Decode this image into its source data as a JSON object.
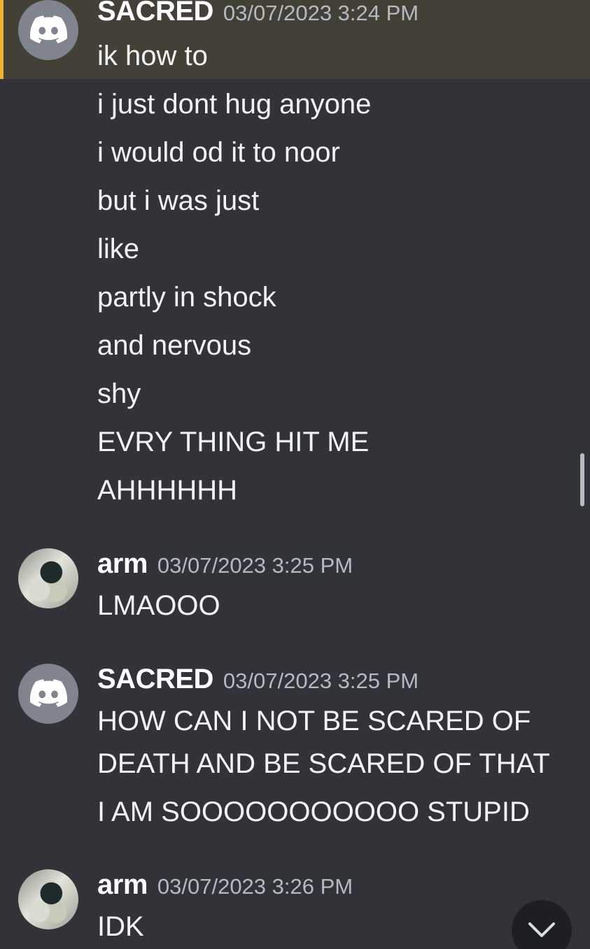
{
  "messages": [
    {
      "author": "SACRED",
      "avatar_icon": "discord-logo-icon",
      "timestamp": "03/07/2023 3:24 PM",
      "highlighted": true,
      "lines": [
        "ik how to",
        "i just dont hug anyone",
        "i would od it to noor",
        "but i was just",
        "like",
        "partly in shock",
        "and nervous",
        "shy",
        "EVRY THING HIT ME",
        "AHHHHHH"
      ]
    },
    {
      "author": "arm",
      "avatar_icon": "user-photo-avatar",
      "timestamp": "03/07/2023 3:25 PM",
      "lines": [
        "LMAOOO"
      ]
    },
    {
      "author": "SACRED",
      "avatar_icon": "discord-logo-icon",
      "timestamp": "03/07/2023 3:25 PM",
      "lines": [
        "HOW CAN I NOT BE SCARED OF",
        "DEATH AND BE SCARED OF THAT",
        "I AM SOOOOOOOOOOO STUPID"
      ]
    },
    {
      "author": "arm",
      "avatar_icon": "user-photo-avatar",
      "timestamp": "03/07/2023 3:26 PM",
      "lines": [
        "IDK"
      ]
    }
  ],
  "jump_button_icon": "chevron-down-icon",
  "colors": {
    "background": "#313338",
    "highlight": "#434137",
    "highlight_bar": "#f0b232",
    "timestamp": "#b5bac1"
  }
}
